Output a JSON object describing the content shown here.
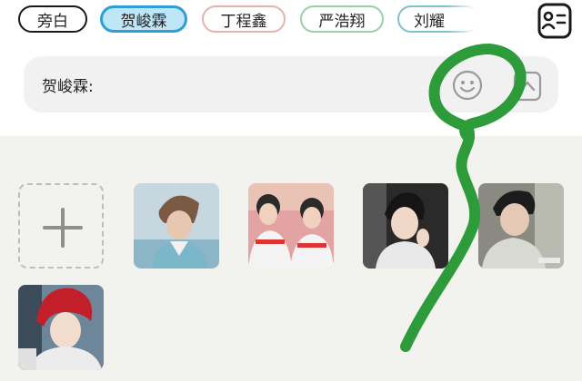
{
  "roles": {
    "chips": [
      {
        "label": "旁白",
        "selected": false
      },
      {
        "label": "贺峻霖",
        "selected": true
      },
      {
        "label": "丁程鑫",
        "selected": false
      },
      {
        "label": "严浩翔",
        "selected": false
      },
      {
        "label": "刘耀",
        "selected": false
      }
    ],
    "profile_icon": "contact-card-icon"
  },
  "composer": {
    "speaker_label": "贺峻霖:",
    "emoji_icon": "smiley-icon",
    "expand_icon": "chevron-up-icon"
  },
  "gallery": {
    "add_icon": "plus-icon",
    "images": [
      {
        "name": "photo-1"
      },
      {
        "name": "photo-2"
      },
      {
        "name": "photo-3"
      },
      {
        "name": "photo-4"
      },
      {
        "name": "photo-5"
      }
    ]
  },
  "colors": {
    "selected_chip_fill": "#bfe6f6",
    "selected_chip_border": "#2c9fd6",
    "panel_background": "#f2f2ee",
    "annotation_stroke": "#2e9b3a"
  }
}
